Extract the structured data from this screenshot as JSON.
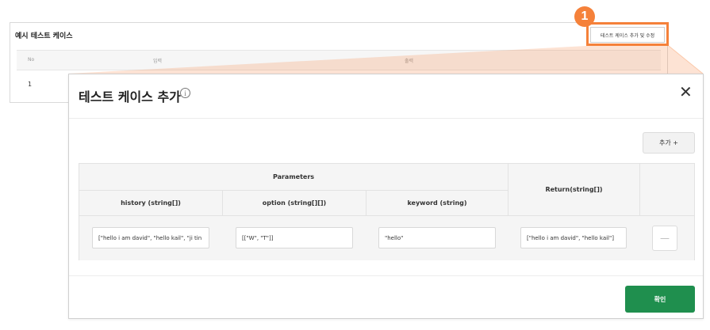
{
  "background": {
    "title": "예시 테스트 케이스",
    "edit_button_label": "테스트 케이스 추가 및 수정",
    "columns": [
      "No",
      "입력",
      "출력"
    ],
    "row_number": "1"
  },
  "annotation": {
    "step": "1",
    "color": "#f5813a"
  },
  "modal": {
    "title": "테스트 케이스 추가",
    "info_icon": "ⓘ",
    "close_icon": "✕",
    "add_button_label": "추가 +",
    "table": {
      "group_header": "Parameters",
      "param_headers": [
        "history (string[])",
        "option (string[][])",
        "keyword (string)"
      ],
      "return_header": "Return(string[])",
      "row": {
        "history": "[\"hello i am david\", \"hello kail\", \"ji tin",
        "option": "[[\"W\", \"T\"]]",
        "keyword": "\"hello\"",
        "return": "[\"hello i am david\", \"hello kail\"]"
      },
      "remove_label": "—"
    },
    "confirm_label": "확인",
    "confirm_color": "#1f8f4e"
  }
}
